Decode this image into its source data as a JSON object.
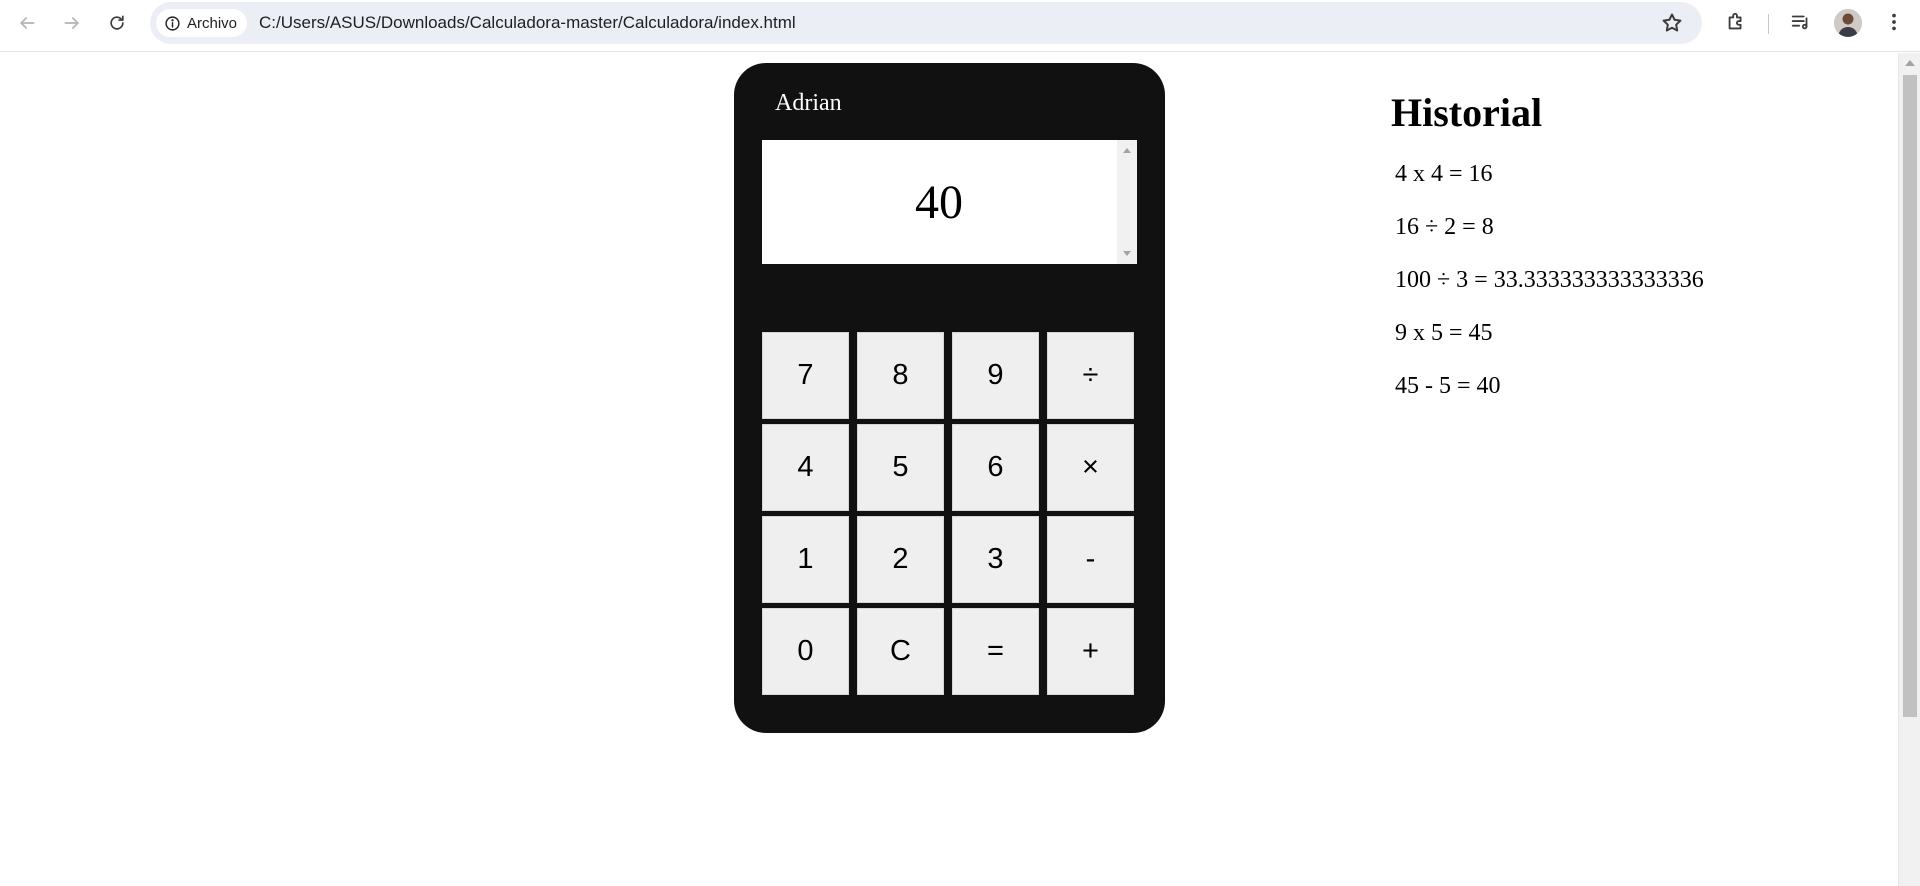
{
  "browser": {
    "back_icon": "arrow-left-icon",
    "forward_icon": "arrow-right-icon",
    "reload_icon": "reload-icon",
    "security_chip": {
      "icon": "info-icon",
      "label": "Archivo"
    },
    "url": "C:/Users/ASUS/Downloads/Calculadora-master/Calculadora/index.html",
    "bookmark_icon": "star-icon",
    "extensions_icon": "puzzle-icon",
    "media_icon": "media-controls-icon",
    "profile_icon": "avatar",
    "menu_icon": "more-vert-icon"
  },
  "calculator": {
    "owner": "Adrian",
    "display": "40",
    "keys": [
      "7",
      "8",
      "9",
      "÷",
      "4",
      "5",
      "6",
      "×",
      "1",
      "2",
      "3",
      "-",
      "0",
      "C",
      "=",
      "+"
    ]
  },
  "history": {
    "title": "Historial",
    "entries": [
      "4 x 4 = 16",
      "16 ÷ 2 = 8",
      "100 ÷ 3 = 33.333333333333336",
      "9 x 5 = 45",
      "45 - 5 = 40"
    ]
  },
  "colors": {
    "calculator_body": "#111111",
    "key_background": "#efefef",
    "omnibox_background": "#ebeef5"
  }
}
